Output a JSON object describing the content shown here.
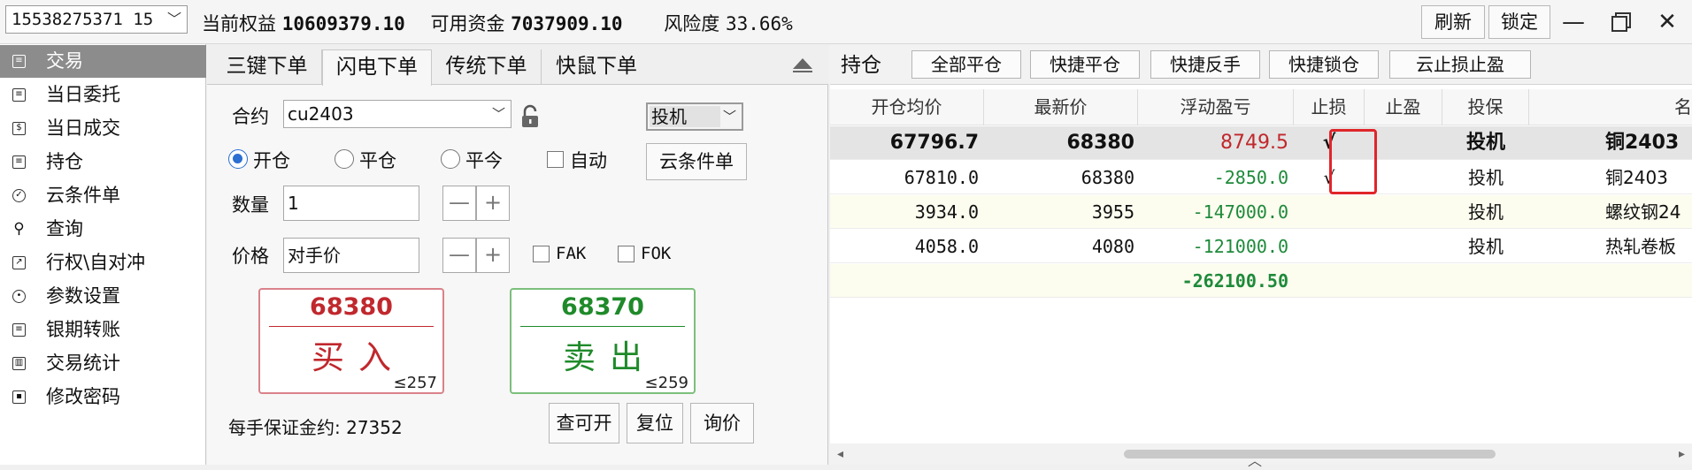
{
  "topbar": {
    "account": "15538275371  15",
    "equity_label": "当前权益",
    "equity_value": "10609379.10",
    "available_label": "可用资金",
    "available_value": "7037909.10",
    "risk_label": "风险度",
    "risk_value": "33.66%",
    "refresh": "刷新",
    "lock": "锁定"
  },
  "sidebar": {
    "items": [
      {
        "label": "交易",
        "icon": "trade-icon"
      },
      {
        "label": "当日委托",
        "icon": "orders-icon"
      },
      {
        "label": "当日成交",
        "icon": "fills-icon"
      },
      {
        "label": "持仓",
        "icon": "positions-icon"
      },
      {
        "label": "云条件单",
        "icon": "cloud-check-icon"
      },
      {
        "label": "查询",
        "icon": "search-icon"
      },
      {
        "label": "行权\\自对冲",
        "icon": "exercise-icon"
      },
      {
        "label": "参数设置",
        "icon": "settings-icon"
      },
      {
        "label": "银期转账",
        "icon": "transfer-icon"
      },
      {
        "label": "交易统计",
        "icon": "stats-icon"
      },
      {
        "label": "修改密码",
        "icon": "password-icon"
      }
    ]
  },
  "order": {
    "tabs": [
      "三键下单",
      "闪电下单",
      "传统下单",
      "快鼠下单"
    ],
    "contract_label": "合约",
    "contract_value": "cu2403",
    "hedge_value": "投机",
    "radios": [
      "开仓",
      "平仓",
      "平今"
    ],
    "auto_label": "自动",
    "cloud_btn": "云条件单",
    "qty_label": "数量",
    "qty_value": "1",
    "price_label": "价格",
    "price_value": "对手价",
    "fak": "FAK",
    "fok": "FOK",
    "buy_price": "68380",
    "buy_label": "买入",
    "buy_qty": "≤257",
    "sell_price": "68370",
    "sell_label": "卖出",
    "sell_qty": "≤259",
    "margin_text": "每手保证金约: 27352",
    "check_btn": "查可开",
    "reset_btn": "复位",
    "quote_btn": "询价"
  },
  "positions": {
    "title": "持仓",
    "actions": [
      "全部平仓",
      "快捷平仓",
      "快捷反手",
      "快捷锁仓",
      "云止损止盈"
    ],
    "columns": [
      "开仓均价",
      "最新价",
      "浮动盈亏",
      "止损",
      "止盈",
      "投保",
      "名"
    ],
    "rows": [
      {
        "avg": "67796.7",
        "last": "68380",
        "pnl": "8749.5",
        "sl": "√",
        "tp": "",
        "hedge": "投机",
        "name": "铜2403"
      },
      {
        "avg": "67810.0",
        "last": "68380",
        "pnl": "-2850.0",
        "sl": "√",
        "tp": "",
        "hedge": "投机",
        "name": "铜2403"
      },
      {
        "avg": "3934.0",
        "last": "3955",
        "pnl": "-147000.0",
        "sl": "",
        "tp": "",
        "hedge": "投机",
        "name": "螺纹钢24"
      },
      {
        "avg": "4058.0",
        "last": "4080",
        "pnl": "-121000.0",
        "sl": "",
        "tp": "",
        "hedge": "投机",
        "name": "热轧卷板"
      }
    ],
    "total_pnl": "-262100.50"
  },
  "colors": {
    "buy": "#c0282d",
    "sell": "#1f8a2a",
    "highlight": "#e0252a",
    "active_sidebar": "#8c8c8c"
  }
}
